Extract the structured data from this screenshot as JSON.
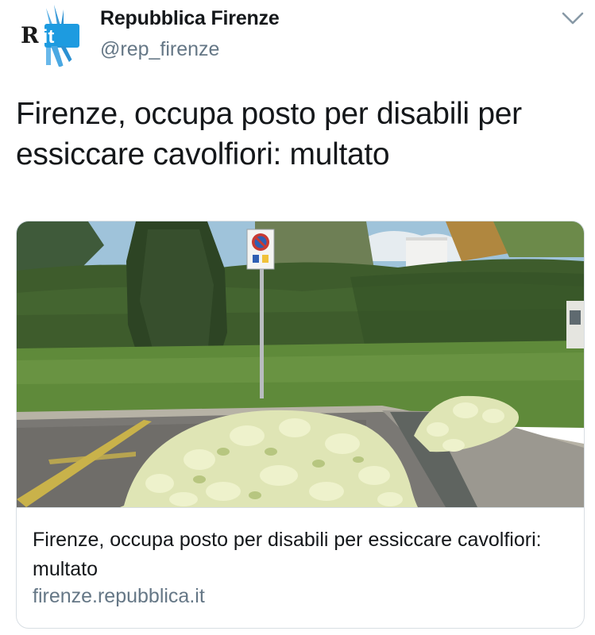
{
  "account": {
    "name": "Repubblica Firenze",
    "handle": "@rep_firenze",
    "avatar_text": "R.it",
    "avatar_color": "#1d9be0"
  },
  "tweet": {
    "text": "Firenze, occupa posto per disabili per essiccare cavolfiori: multato"
  },
  "card": {
    "image_icon": "photo-parking-spot-with-cauliflowers",
    "sign_icon": "no-parking-disabled-sign",
    "title": "Firenze, occupa posto per disabili per essiccare cavolfiori: multato",
    "domain": "firenze.repubblica.it"
  },
  "colors": {
    "text_primary": "#14171a",
    "text_secondary": "#657786",
    "border": "#d8dee3",
    "brand_blue": "#1d9be0"
  },
  "icons": {
    "menu": "chevron-down-icon"
  }
}
